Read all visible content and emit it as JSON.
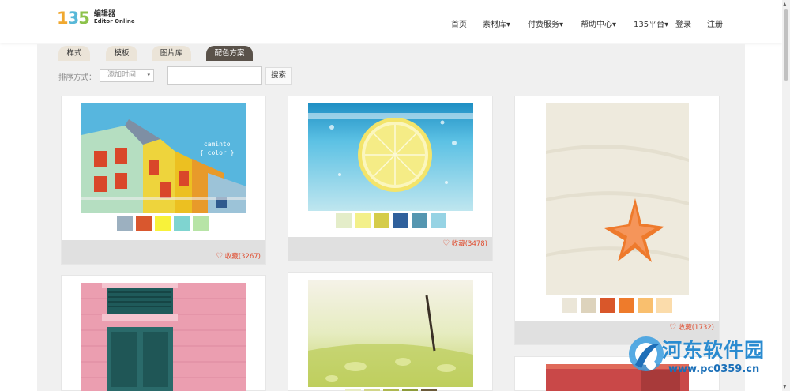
{
  "header": {
    "logo_number": "135",
    "logo_cn": "编辑器",
    "logo_en": "Editor Online",
    "nav": [
      "首页",
      "素材库▾",
      "付费服务▾",
      "帮助中心▾",
      "135平台▾",
      "登录",
      "注册"
    ]
  },
  "tabs": [
    "样式",
    "模板",
    "图片库",
    "配色方案"
  ],
  "active_tab": "配色方案",
  "sort": {
    "label": "排序方式：",
    "value": "添加时间",
    "arrow": "▾"
  },
  "search": {
    "placeholder": "",
    "button": "搜索"
  },
  "cards": [
    {
      "photo_text": "caminto\n{ color }",
      "swatches": [
        "#9cb0c0",
        "#d9572e",
        "#f8f23a",
        "#7fd4d0",
        "#b7e4a6"
      ],
      "fav_label": "收藏(3267)"
    },
    {
      "swatches": [
        "#e4edc9",
        "#f3f08a",
        "#d5cc4a",
        "#2f609c",
        "#5596b0",
        "#96d3e4"
      ],
      "fav_label": "收藏(3478)"
    },
    {
      "swatches": [
        "#ebe6d8",
        "#ddd3bc",
        "#d9572a",
        "#ee7b2b",
        "#f9bf6e",
        "#fbdcab"
      ],
      "fav_label": "收藏(1732)"
    },
    {
      "swatches": [],
      "fav_label": ""
    },
    {
      "swatches": [
        "#e8ecc5",
        "#d2d68a",
        "#aeb850",
        "#8e9c3a",
        "#6c5c3a"
      ],
      "fav_label": ""
    },
    {
      "swatches": [],
      "fav_label": ""
    }
  ],
  "watermark": {
    "title": "河东软件园",
    "url": "www.pc0359.cn"
  },
  "icons": {
    "heart": "♡",
    "scroll_up": "▲",
    "scroll_down": "▼"
  }
}
